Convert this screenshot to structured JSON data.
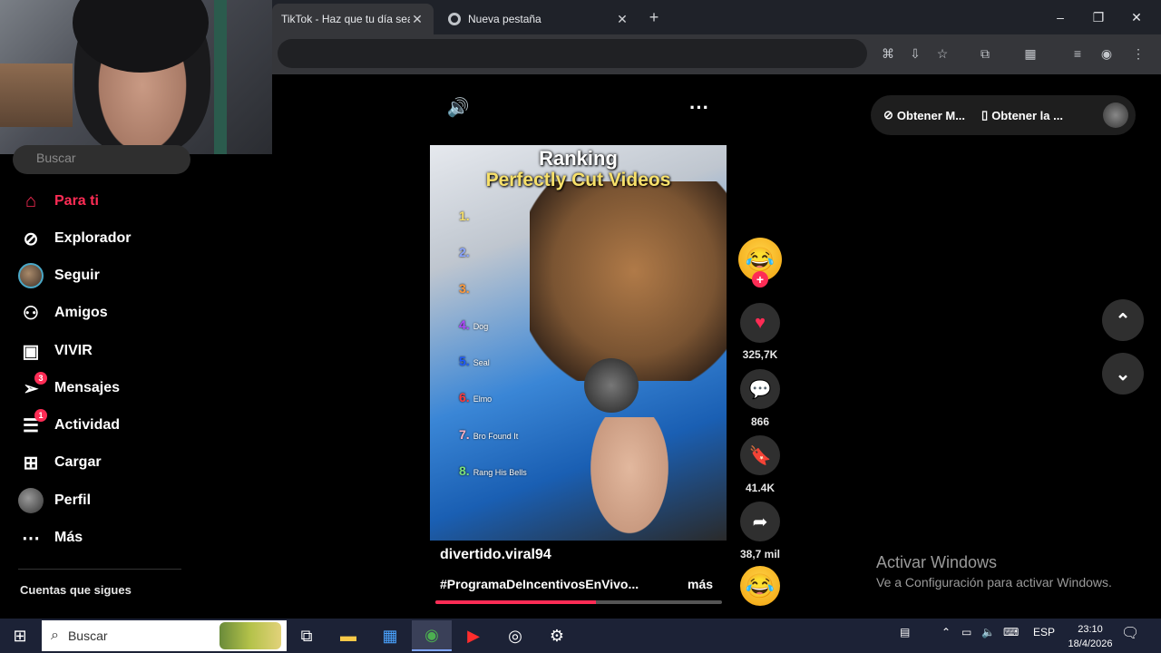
{
  "browser": {
    "tabs": [
      {
        "title": "TikTok - Haz que tu día sea e",
        "active": true
      },
      {
        "title": "Nueva pestaña",
        "active": false
      }
    ],
    "new_tab": "+",
    "window_controls": {
      "minimize": "–",
      "restore": "❐",
      "close": "✕"
    }
  },
  "sidebar": {
    "search_placeholder": "Buscar",
    "items": [
      {
        "label": "Para ti",
        "icon": "home-icon",
        "active": true,
        "badge": ""
      },
      {
        "label": "Explorador",
        "icon": "compass-icon",
        "badge": ""
      },
      {
        "label": "Seguir",
        "icon": "avatar",
        "badge": ""
      },
      {
        "label": "Amigos",
        "icon": "friends-icon",
        "badge": ""
      },
      {
        "label": "VIVIR",
        "icon": "live-icon",
        "badge": ""
      },
      {
        "label": "Mensajes",
        "icon": "messages-icon",
        "badge": "3"
      },
      {
        "label": "Actividad",
        "icon": "activity-icon",
        "badge": "1"
      },
      {
        "label": "Cargar",
        "icon": "upload-icon",
        "badge": ""
      },
      {
        "label": "Perfil",
        "icon": "profile-avatar",
        "badge": ""
      },
      {
        "label": "Más",
        "icon": "more-icon",
        "badge": ""
      }
    ],
    "following_title": "Cuentas que sigues"
  },
  "video": {
    "overlay_title_1": "Ranking",
    "overlay_title_2": "Perfectly Cut Videos",
    "ranks": [
      {
        "num": "1.",
        "label": "",
        "color": "#f7e06a"
      },
      {
        "num": "2.",
        "label": "",
        "color": "#8aa4ff"
      },
      {
        "num": "3.",
        "label": "",
        "color": "#ff9a3c"
      },
      {
        "num": "4.",
        "label": "Dog",
        "color": "#b048ff"
      },
      {
        "num": "5.",
        "label": "Seal",
        "color": "#1f5bff"
      },
      {
        "num": "6.",
        "label": "Elmo",
        "color": "#ff3b3b"
      },
      {
        "num": "7.",
        "label": "Bro Found It",
        "color": "#ffb3c6"
      },
      {
        "num": "8.",
        "label": "Rang His Bells",
        "color": "#7be07b"
      }
    ],
    "author": "divertido.viral94",
    "hashtag": "#ProgramaDeIncentivosEnVivo...",
    "more": "más",
    "progress": 0.56
  },
  "actions": {
    "likes": "325,7K",
    "comments": "866",
    "saves": "41.4K",
    "shares": "38,7 mil"
  },
  "top_pill": {
    "item1": "Obtener M...",
    "item2": "Obtener la ..."
  },
  "watermark": {
    "line1": "Activar Windows",
    "line2": "Ve a Configuración para activar Windows."
  },
  "taskbar": {
    "search": "Buscar",
    "lang": "ESP",
    "time": "23:10",
    "date": "18/4/2026"
  },
  "colors": {
    "accent": "#fe2c55"
  }
}
